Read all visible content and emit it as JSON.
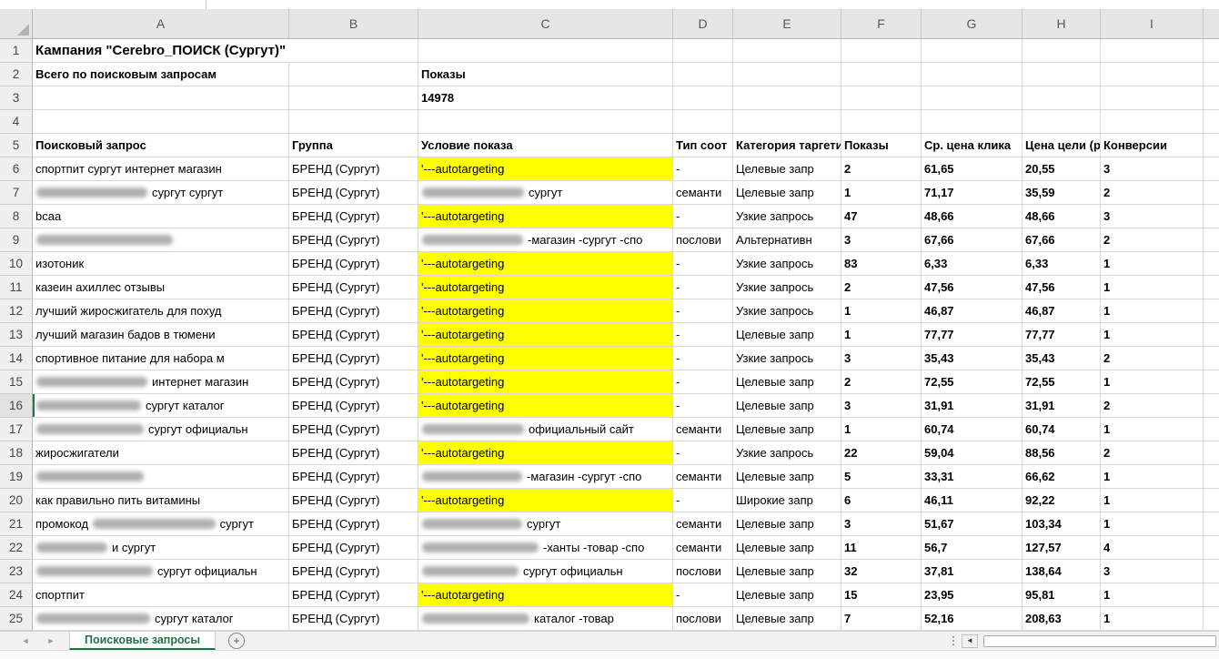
{
  "sheet": {
    "column_letters": [
      "A",
      "B",
      "C",
      "D",
      "E",
      "F",
      "G",
      "H",
      "I"
    ],
    "rows": [
      {
        "n": "1",
        "cells": [
          {
            "t": "Кампания \"Cerebro_ПОИСК (Сургут)\"",
            "title": true,
            "s": 2
          },
          {},
          {},
          {},
          {},
          {},
          {},
          {}
        ]
      },
      {
        "n": "2",
        "cells": [
          {
            "t": "Всего по поисковым запросам",
            "bold": true
          },
          {},
          {
            "t": "Показы",
            "bold": true
          },
          {},
          {},
          {},
          {},
          {},
          {}
        ]
      },
      {
        "n": "3",
        "cells": [
          {},
          {},
          {
            "t": "14978",
            "bold": true
          },
          {},
          {},
          {},
          {},
          {},
          {}
        ]
      },
      {
        "n": "4",
        "cells": [
          {},
          {},
          {},
          {},
          {},
          {},
          {},
          {},
          {}
        ]
      },
      {
        "n": "5",
        "cells": [
          {
            "t": "Поисковый запрос",
            "bold": true
          },
          {
            "t": "Группа",
            "bold": true
          },
          {
            "t": "Условие показа",
            "bold": true
          },
          {
            "t": "Тип соот",
            "bold": true
          },
          {
            "t": "Категория таргети",
            "bold": true
          },
          {
            "t": "Показы",
            "bold": true
          },
          {
            "t": "Ср. цена клика",
            "bold": true
          },
          {
            "t": "Цена цели (ру",
            "bold": true
          },
          {
            "t": "Конверсии",
            "bold": true
          }
        ]
      },
      {
        "n": "6",
        "cells": [
          {
            "t": "спортпит сургут интернет магазин"
          },
          {
            "t": "БРЕНД (Сургут)"
          },
          {
            "t": "'---autotargeting",
            "y": true
          },
          {
            "t": "-"
          },
          {
            "t": "Целевые запр"
          },
          {
            "t": "2",
            "bold": true
          },
          {
            "t": "61,65",
            "bold": true
          },
          {
            "t": "20,55",
            "bold": true
          },
          {
            "t": "3",
            "bold": true
          }
        ]
      },
      {
        "n": "7",
        "cells": [
          {
            "parts": [
              {
                "b": 122
              },
              {
                "t": "сургут сургут"
              }
            ]
          },
          {
            "t": "БРЕНД (Сургут)"
          },
          {
            "parts": [
              {
                "b": 112
              },
              {
                "t": "сургут"
              }
            ]
          },
          {
            "t": "семанти"
          },
          {
            "t": "Целевые запр"
          },
          {
            "t": "1",
            "bold": true
          },
          {
            "t": "71,17",
            "bold": true
          },
          {
            "t": "35,59",
            "bold": true
          },
          {
            "t": "2",
            "bold": true
          }
        ]
      },
      {
        "n": "8",
        "cells": [
          {
            "t": "bcaa"
          },
          {
            "t": "БРЕНД (Сургут)"
          },
          {
            "t": "'---autotargeting",
            "y": true
          },
          {
            "t": "-"
          },
          {
            "t": "Узкие запрось"
          },
          {
            "t": "47",
            "bold": true
          },
          {
            "t": "48,66",
            "bold": true
          },
          {
            "t": "48,66",
            "bold": true
          },
          {
            "t": "3",
            "bold": true
          }
        ]
      },
      {
        "n": "9",
        "cells": [
          {
            "parts": [
              {
                "b": 150
              }
            ]
          },
          {
            "t": "БРЕНД (Сургут)"
          },
          {
            "parts": [
              {
                "b": 111
              },
              {
                "t": "-магазин -сургут -спо"
              }
            ]
          },
          {
            "t": "послови"
          },
          {
            "t": "Альтернативн"
          },
          {
            "t": "3",
            "bold": true
          },
          {
            "t": "67,66",
            "bold": true
          },
          {
            "t": "67,66",
            "bold": true
          },
          {
            "t": "2",
            "bold": true
          }
        ]
      },
      {
        "n": "10",
        "cells": [
          {
            "t": "изотоник"
          },
          {
            "t": "БРЕНД (Сургут)"
          },
          {
            "t": "'---autotargeting",
            "y": true
          },
          {
            "t": "-"
          },
          {
            "t": "Узкие запрось"
          },
          {
            "t": "83",
            "bold": true
          },
          {
            "t": "6,33",
            "bold": true
          },
          {
            "t": "6,33",
            "bold": true
          },
          {
            "t": "1",
            "bold": true
          }
        ]
      },
      {
        "n": "11",
        "cells": [
          {
            "t": "казеин ахиллес отзывы"
          },
          {
            "t": "БРЕНД (Сургут)"
          },
          {
            "t": "'---autotargeting",
            "y": true
          },
          {
            "t": "-"
          },
          {
            "t": "Узкие запрось"
          },
          {
            "t": "2",
            "bold": true
          },
          {
            "t": "47,56",
            "bold": true
          },
          {
            "t": "47,56",
            "bold": true
          },
          {
            "t": "1",
            "bold": true
          }
        ]
      },
      {
        "n": "12",
        "cells": [
          {
            "t": "лучший жиросжигатель для похуд"
          },
          {
            "t": "БРЕНД (Сургут)"
          },
          {
            "t": "'---autotargeting",
            "y": true
          },
          {
            "t": "-"
          },
          {
            "t": "Узкие запрось"
          },
          {
            "t": "1",
            "bold": true
          },
          {
            "t": "46,87",
            "bold": true
          },
          {
            "t": "46,87",
            "bold": true
          },
          {
            "t": "1",
            "bold": true
          }
        ]
      },
      {
        "n": "13",
        "cells": [
          {
            "t": "лучший магазин бадов в тюмени"
          },
          {
            "t": "БРЕНД (Сургут)"
          },
          {
            "t": "'---autotargeting",
            "y": true
          },
          {
            "t": "-"
          },
          {
            "t": "Целевые запр"
          },
          {
            "t": "1",
            "bold": true
          },
          {
            "t": "77,77",
            "bold": true
          },
          {
            "t": "77,77",
            "bold": true
          },
          {
            "t": "1",
            "bold": true
          }
        ]
      },
      {
        "n": "14",
        "cells": [
          {
            "t": "спортивное питание для набора м"
          },
          {
            "t": "БРЕНД (Сургут)"
          },
          {
            "t": "'---autotargeting",
            "y": true
          },
          {
            "t": "-"
          },
          {
            "t": "Узкие запрось"
          },
          {
            "t": "3",
            "bold": true
          },
          {
            "t": "35,43",
            "bold": true
          },
          {
            "t": "35,43",
            "bold": true
          },
          {
            "t": "2",
            "bold": true
          }
        ]
      },
      {
        "n": "15",
        "cells": [
          {
            "parts": [
              {
                "b": 122
              },
              {
                "t": "интернет магазин"
              }
            ]
          },
          {
            "t": "БРЕНД (Сургут)"
          },
          {
            "t": "'---autotargeting",
            "y": true
          },
          {
            "t": "-"
          },
          {
            "t": "Целевые запр"
          },
          {
            "t": "2",
            "bold": true
          },
          {
            "t": "72,55",
            "bold": true
          },
          {
            "t": "72,55",
            "bold": true
          },
          {
            "t": "1",
            "bold": true
          }
        ]
      },
      {
        "n": "16",
        "sel": true,
        "cells": [
          {
            "parts": [
              {
                "b": 115
              },
              {
                "t": "сургут каталог"
              }
            ]
          },
          {
            "t": "БРЕНД (Сургут)"
          },
          {
            "t": "'---autotargeting",
            "y": true
          },
          {
            "t": "-"
          },
          {
            "t": "Целевые запр"
          },
          {
            "t": "3",
            "bold": true
          },
          {
            "t": "31,91",
            "bold": true
          },
          {
            "t": "31,91",
            "bold": true
          },
          {
            "t": "2",
            "bold": true
          }
        ]
      },
      {
        "n": "17",
        "cells": [
          {
            "parts": [
              {
                "b": 118
              },
              {
                "t": "сургут официальн"
              }
            ]
          },
          {
            "t": "БРЕНД (Сургут)"
          },
          {
            "parts": [
              {
                "b": 112
              },
              {
                "t": "официальный сайт"
              }
            ]
          },
          {
            "t": "семанти"
          },
          {
            "t": "Целевые запр"
          },
          {
            "t": "1",
            "bold": true
          },
          {
            "t": "60,74",
            "bold": true
          },
          {
            "t": "60,74",
            "bold": true
          },
          {
            "t": "1",
            "bold": true
          }
        ]
      },
      {
        "n": "18",
        "cells": [
          {
            "t": "жиросжигатели"
          },
          {
            "t": "БРЕНД (Сургут)"
          },
          {
            "t": "'---autotargeting",
            "y": true
          },
          {
            "t": "-"
          },
          {
            "t": "Узкие запрось"
          },
          {
            "t": "22",
            "bold": true
          },
          {
            "t": "59,04",
            "bold": true
          },
          {
            "t": "88,56",
            "bold": true
          },
          {
            "t": "2",
            "bold": true
          }
        ]
      },
      {
        "n": "19",
        "cells": [
          {
            "parts": [
              {
                "b": 118
              }
            ]
          },
          {
            "t": "БРЕНД (Сургут)"
          },
          {
            "parts": [
              {
                "b": 110
              },
              {
                "t": "-магазин -сургут -спо"
              }
            ]
          },
          {
            "t": "семанти"
          },
          {
            "t": "Целевые запр"
          },
          {
            "t": "5",
            "bold": true
          },
          {
            "t": "33,31",
            "bold": true
          },
          {
            "t": "66,62",
            "bold": true
          },
          {
            "t": "1",
            "bold": true
          }
        ]
      },
      {
        "n": "20",
        "cells": [
          {
            "t": "как правильно пить витамины"
          },
          {
            "t": "БРЕНД (Сургут)"
          },
          {
            "t": "'---autotargeting",
            "y": true
          },
          {
            "t": "-"
          },
          {
            "t": "Широкие запр"
          },
          {
            "t": "6",
            "bold": true
          },
          {
            "t": "46,11",
            "bold": true
          },
          {
            "t": "92,22",
            "bold": true
          },
          {
            "t": "1",
            "bold": true
          }
        ]
      },
      {
        "n": "21",
        "cells": [
          {
            "parts": [
              {
                "t": "промокод "
              },
              {
                "b": 135
              },
              {
                "t": "сургут"
              }
            ]
          },
          {
            "t": "БРЕНД (Сургут)"
          },
          {
            "parts": [
              {
                "b": 110
              },
              {
                "t": "сургут"
              }
            ]
          },
          {
            "t": "семанти"
          },
          {
            "t": "Целевые запр"
          },
          {
            "t": "3",
            "bold": true
          },
          {
            "t": "51,67",
            "bold": true
          },
          {
            "t": "103,34",
            "bold": true
          },
          {
            "t": "1",
            "bold": true
          }
        ]
      },
      {
        "n": "22",
        "cells": [
          {
            "parts": [
              {
                "b": 78
              },
              {
                "t": "и сургут"
              }
            ]
          },
          {
            "t": "БРЕНД (Сургут)"
          },
          {
            "parts": [
              {
                "b": 128
              },
              {
                "t": "-ханты -товар -спо"
              }
            ]
          },
          {
            "t": "семанти"
          },
          {
            "t": "Целевые запр"
          },
          {
            "t": "11",
            "bold": true
          },
          {
            "t": "56,7",
            "bold": true
          },
          {
            "t": "127,57",
            "bold": true
          },
          {
            "t": "4",
            "bold": true
          }
        ]
      },
      {
        "n": "23",
        "cells": [
          {
            "parts": [
              {
                "b": 128
              },
              {
                "t": "сургут официальн"
              }
            ]
          },
          {
            "t": "БРЕНД (Сургут)"
          },
          {
            "parts": [
              {
                "b": 106
              },
              {
                "t": "сургут официальн"
              }
            ]
          },
          {
            "t": "послови"
          },
          {
            "t": "Целевые запр"
          },
          {
            "t": "32",
            "bold": true
          },
          {
            "t": "37,81",
            "bold": true
          },
          {
            "t": "138,64",
            "bold": true
          },
          {
            "t": "3",
            "bold": true
          }
        ]
      },
      {
        "n": "24",
        "cells": [
          {
            "t": "спортпит"
          },
          {
            "t": "БРЕНД (Сургут)"
          },
          {
            "t": "'---autotargeting",
            "y": true
          },
          {
            "t": "-"
          },
          {
            "t": "Целевые запр"
          },
          {
            "t": "15",
            "bold": true
          },
          {
            "t": "23,95",
            "bold": true
          },
          {
            "t": "95,81",
            "bold": true
          },
          {
            "t": "1",
            "bold": true
          }
        ]
      },
      {
        "n": "25",
        "cells": [
          {
            "parts": [
              {
                "b": 125
              },
              {
                "t": "сургут каталог"
              }
            ]
          },
          {
            "t": "БРЕНД (Сургут)"
          },
          {
            "parts": [
              {
                "b": 118
              },
              {
                "t": "каталог -товар"
              }
            ]
          },
          {
            "t": "послови"
          },
          {
            "t": "Целевые запр"
          },
          {
            "t": "7",
            "bold": true
          },
          {
            "t": "52,16",
            "bold": true
          },
          {
            "t": "208,63",
            "bold": true
          },
          {
            "t": "1",
            "bold": true
          }
        ]
      }
    ]
  },
  "tab_bar": {
    "active_tab": "Поисковые запросы",
    "add_label": "+",
    "icons": {
      "prev": "◄",
      "next": "►",
      "scroll_left": "◄"
    }
  },
  "colors": {
    "highlight": "#ffff00",
    "tab_green": "#217346"
  }
}
